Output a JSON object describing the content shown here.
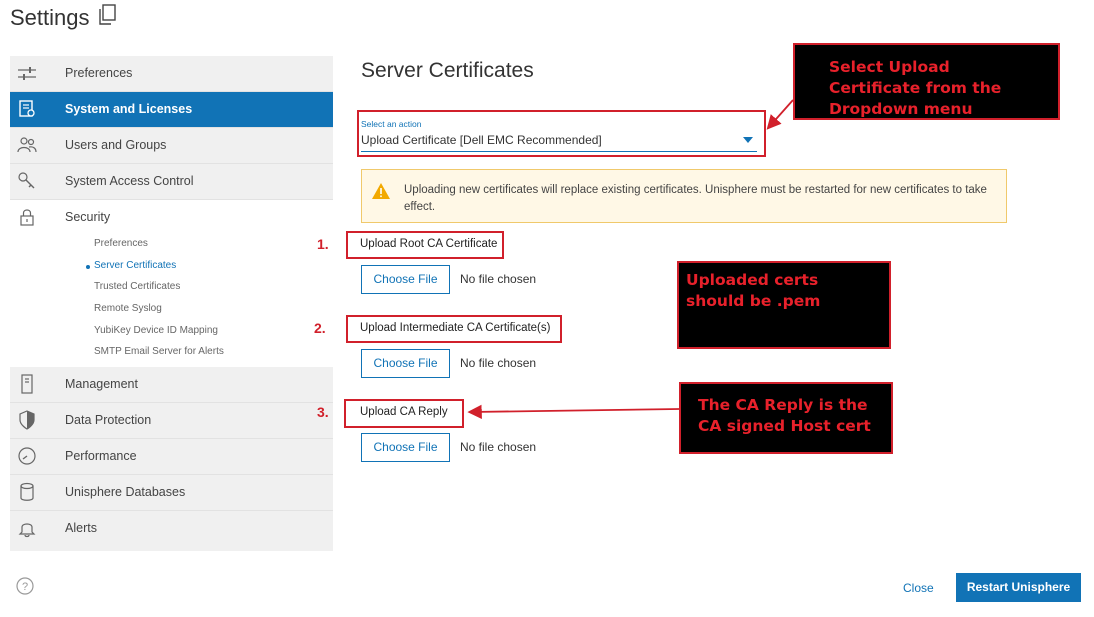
{
  "header": {
    "title": "Settings",
    "copy_icon": "copy-icon"
  },
  "sidebar": {
    "items": [
      {
        "label": "Preferences",
        "icon": "sliders-icon"
      },
      {
        "label": "System and Licenses",
        "icon": "license-icon",
        "active": true
      },
      {
        "label": "Users and Groups",
        "icon": "users-icon"
      },
      {
        "label": "System Access Control",
        "icon": "key-icon"
      },
      {
        "label": "Security",
        "icon": "lock-icon",
        "expanded": true
      },
      {
        "label": "Management",
        "icon": "server-icon"
      },
      {
        "label": "Data Protection",
        "icon": "shield-icon"
      },
      {
        "label": "Performance",
        "icon": "gauge-icon"
      },
      {
        "label": "Unisphere Databases",
        "icon": "database-icon"
      },
      {
        "label": "Alerts",
        "icon": "bell-icon"
      }
    ],
    "security_subitems": [
      "Preferences",
      "Server Certificates",
      "Trusted Certificates",
      "Remote Syslog",
      "YubiKey Device ID Mapping",
      "SMTP Email Server for Alerts"
    ],
    "active_subitem": "Server Certificates"
  },
  "main": {
    "title": "Server Certificates",
    "action_select": {
      "label": "Select an action",
      "value": "Upload Certificate [Dell EMC Recommended]"
    },
    "warning": "Uploading new certificates will replace existing certificates. Unisphere must be restarted for new certificates to take effect.",
    "uploads": [
      {
        "number": "1.",
        "title": "Upload Root CA Certificate",
        "button": "Choose File",
        "status": "No file chosen"
      },
      {
        "number": "2.",
        "title": "Upload Intermediate CA Certificate(s)",
        "button": "Choose File",
        "status": "No file chosen"
      },
      {
        "number": "3.",
        "title": "Upload CA Reply",
        "button": "Choose File",
        "status": "No file chosen"
      }
    ]
  },
  "annotations": {
    "dropdown_note": "Select Upload Certificate from the Dropdown menu",
    "pem_note": "Uploaded certs should be .pem",
    "ca_reply_note": "The CA Reply is the CA signed Host cert",
    "accent_color": "#d1202b"
  },
  "footer": {
    "close_label": "Close",
    "restart_label": "Restart Unisphere"
  },
  "colors": {
    "primary": "#1173b6",
    "sidebar_bg": "#f0f0f0",
    "warning_bg": "#fff8e6"
  }
}
